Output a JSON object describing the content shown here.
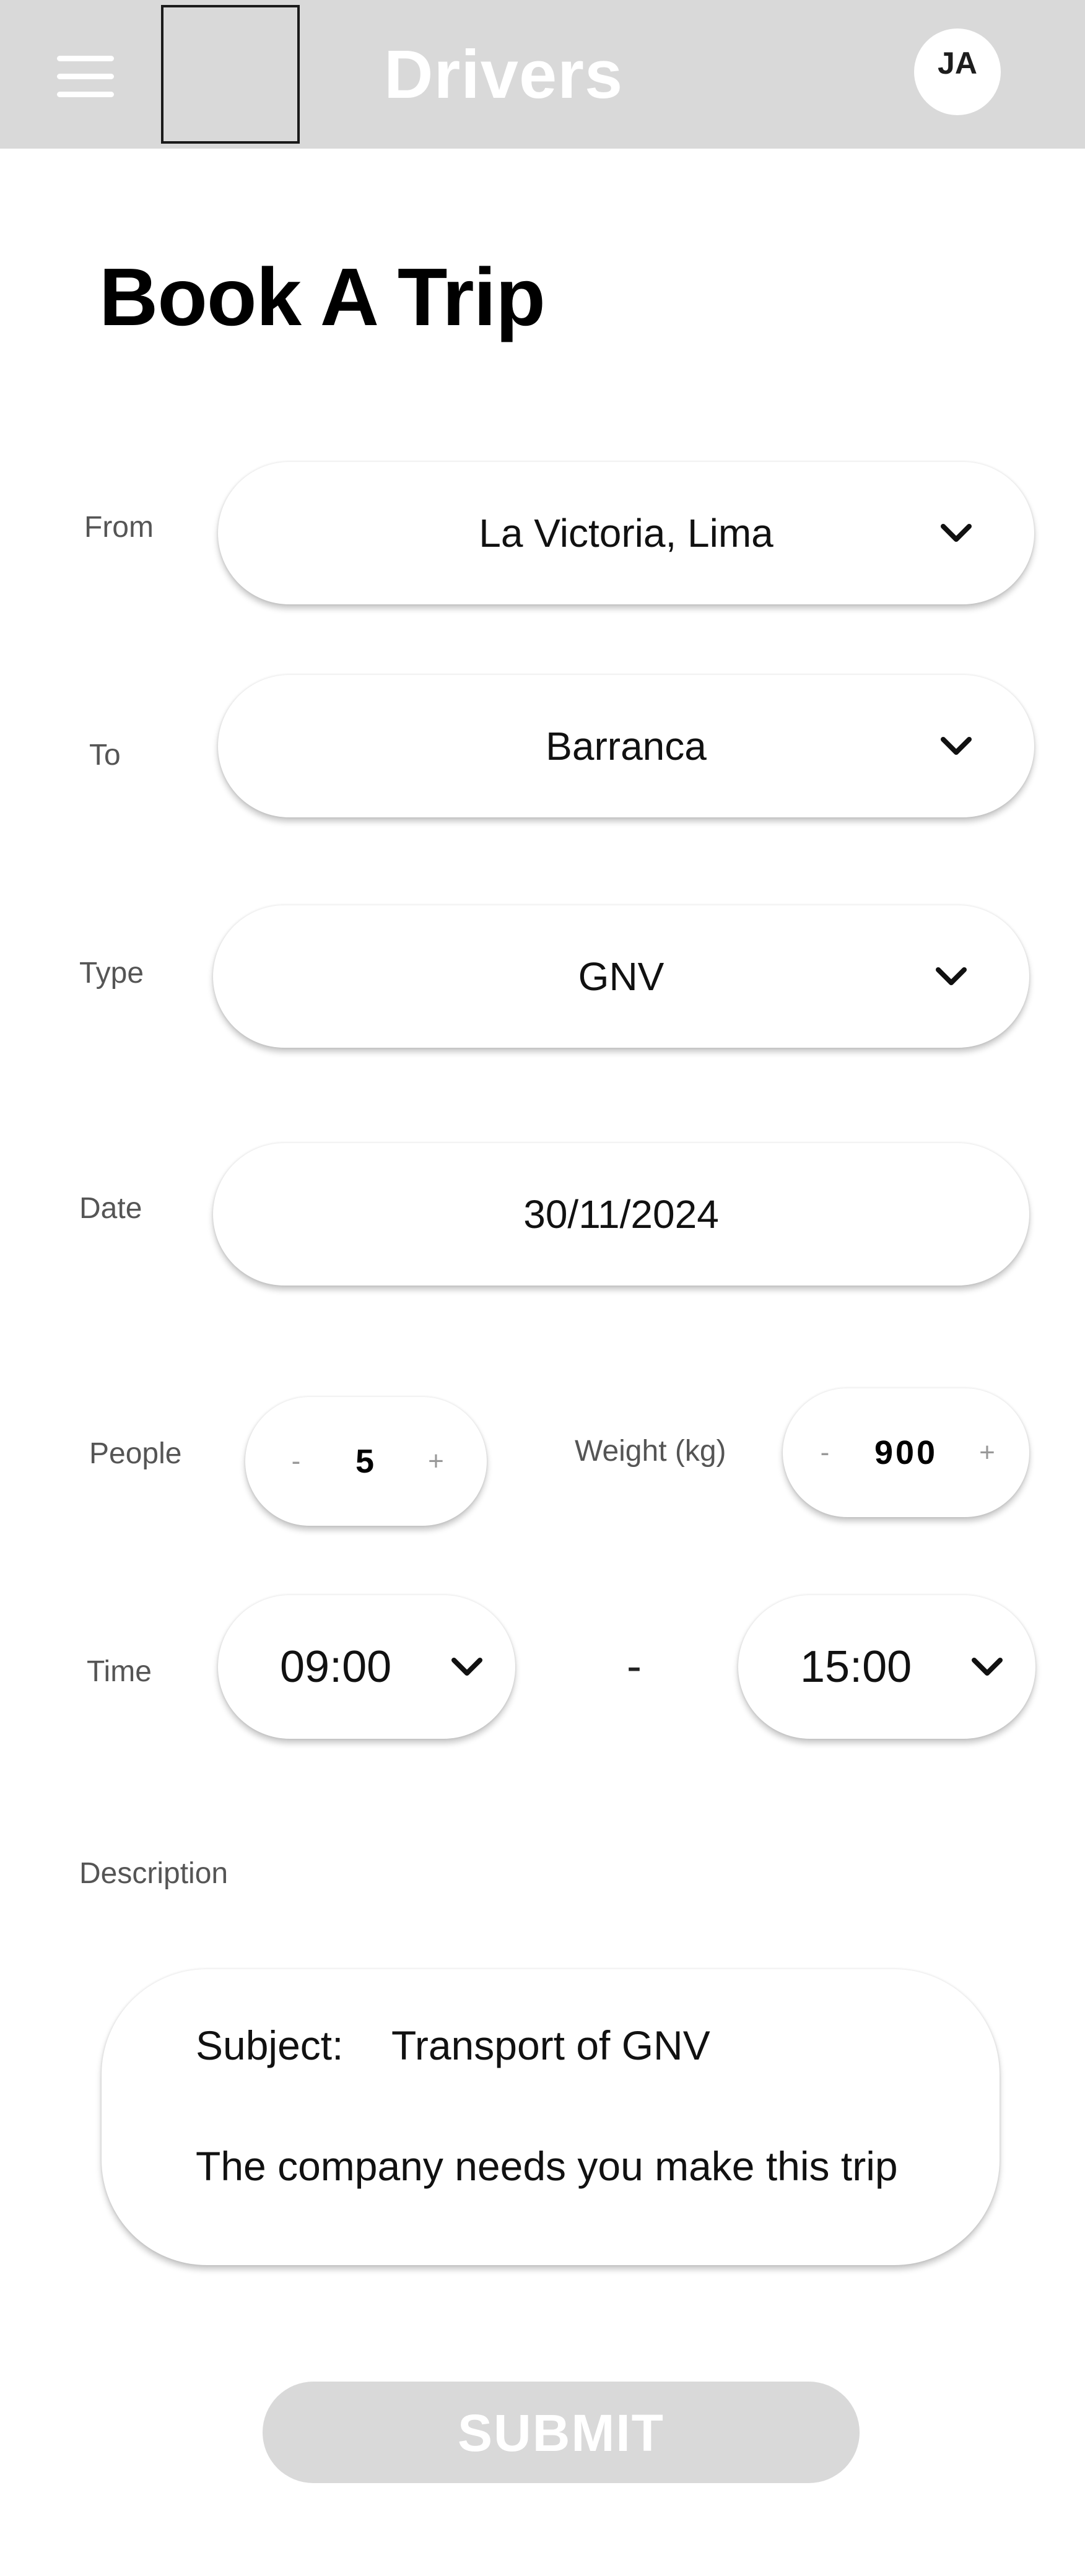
{
  "header": {
    "title": "Drivers",
    "avatar_initials": "JA"
  },
  "page_title": "Book A Trip",
  "form": {
    "from": {
      "label": "From",
      "value": "La Victoria, Lima"
    },
    "to": {
      "label": "To",
      "value": "Barranca"
    },
    "type": {
      "label": "Type",
      "value": "GNV"
    },
    "date": {
      "label": "Date",
      "value": "30/11/2024"
    },
    "people": {
      "label": "People",
      "value": "5",
      "minus": "-",
      "plus": "+"
    },
    "weight": {
      "label": "Weight (kg)",
      "value": "900",
      "minus": "-",
      "plus": "+"
    },
    "time": {
      "label": "Time",
      "start": "09:00",
      "separator": "-",
      "end": "15:00"
    },
    "description": {
      "label": "Description",
      "subject_label": "Subject:",
      "subject_value": "Transport of GNV",
      "body": "The company needs you make this trip"
    },
    "submit_label": "SUBMIT"
  }
}
